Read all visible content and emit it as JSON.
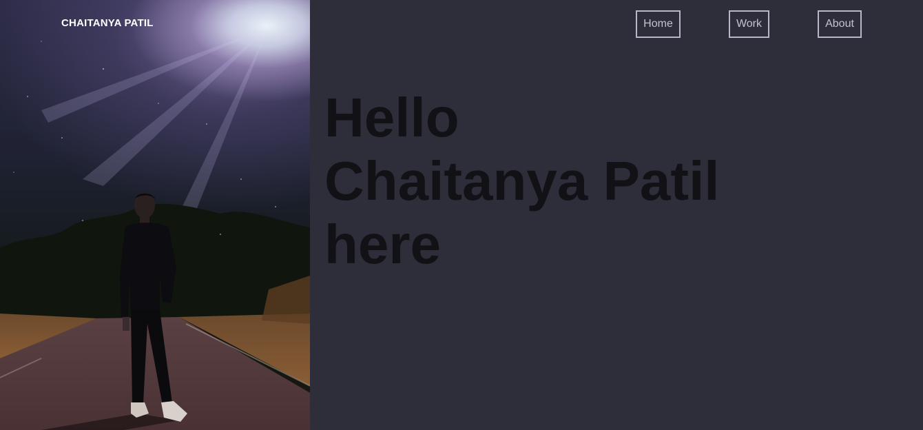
{
  "brand": {
    "name": "CHAITANYA PATIL"
  },
  "nav": {
    "home_label": "Home",
    "work_label": "Work",
    "about_label": "About"
  },
  "hero": {
    "line1": "Hello",
    "line2": "Chaitanya Patil",
    "line3": "here"
  },
  "colors": {
    "background": "#2e2d3a",
    "headline": "#111116",
    "nav_border": "#b7b8c9",
    "brand": "#ffffff"
  }
}
